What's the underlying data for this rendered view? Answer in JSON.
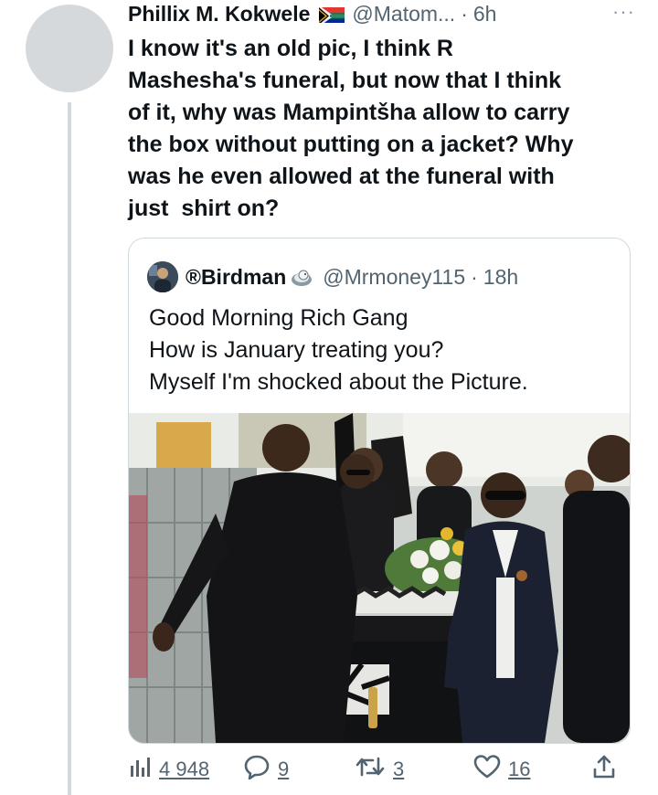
{
  "tweet": {
    "author_name": "Phillix M. Kokwele",
    "handle": "@Matom...",
    "separator": "·",
    "time": "6h",
    "more_label": "···",
    "text": "I know it's an old pic, I think R\nMashesha's funeral, but now that I think\nof it, why was Mampintšha allow to carry\nthe box without putting on a jacket? Why\nwas he even allowed at the funeral with\njust  shirt on?"
  },
  "quoted": {
    "author_name": "®Birdman",
    "handle": "@Mrmoney115",
    "separator": "·",
    "time": "18h",
    "text": "Good Morning Rich Gang\nHow is January treating you?\nMyself I'm shocked about the Picture."
  },
  "actions": {
    "views": "4 948",
    "replies": "9",
    "retweets": "3",
    "likes": "16"
  },
  "colors": {
    "text": "#0f1419",
    "secondary": "#536471",
    "border": "#cfd9de"
  },
  "icons": [
    "views-icon",
    "reply-icon",
    "retweet-icon",
    "like-icon",
    "share-icon",
    "more-icon",
    "south-africa-flag-icon"
  ]
}
